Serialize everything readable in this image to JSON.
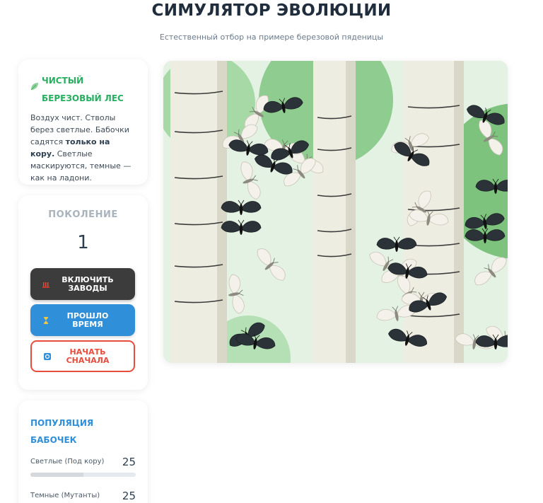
{
  "header": {
    "title": "СИМУЛЯТОР ЭВОЛЮЦИИ",
    "subtitle": "Естественный отбор на примере березовой пяденицы"
  },
  "info_card": {
    "title_line1": "Чистый",
    "title_line2": "березовый лес",
    "text_part1": "Воздух чист. Стволы берез светлые. Бабочки садятся ",
    "text_bold": "только на кору.",
    "text_part2": " Светлые маскируются, темные — как на ладони."
  },
  "generation": {
    "label": "ПОКОЛЕНИЕ",
    "value": "1"
  },
  "controls": {
    "factories_label_1": "Включить",
    "factories_label_2": "заводы",
    "time_label_1": "Прошло",
    "time_label_2": "время",
    "restart_label_1": "Начать",
    "restart_label_2": "сначала"
  },
  "population": {
    "title_line1": "Популяция",
    "title_line2": "бабочек",
    "light": {
      "name": "Светлые (Под кору)",
      "count": "25",
      "fraction": 0.5
    },
    "dark": {
      "name": "Темные (Мутанты)",
      "count": "25",
      "fraction": 0.5
    }
  },
  "colors": {
    "accent_green": "#27ae60",
    "accent_blue": "#2f8fd8",
    "danger_red": "#e74c3c",
    "dark_button": "#3c3c3c"
  },
  "icons": {
    "info": "leaf-icon",
    "factories": "factory-icon",
    "time": "hourglass-icon",
    "restart": "restart-icon"
  }
}
